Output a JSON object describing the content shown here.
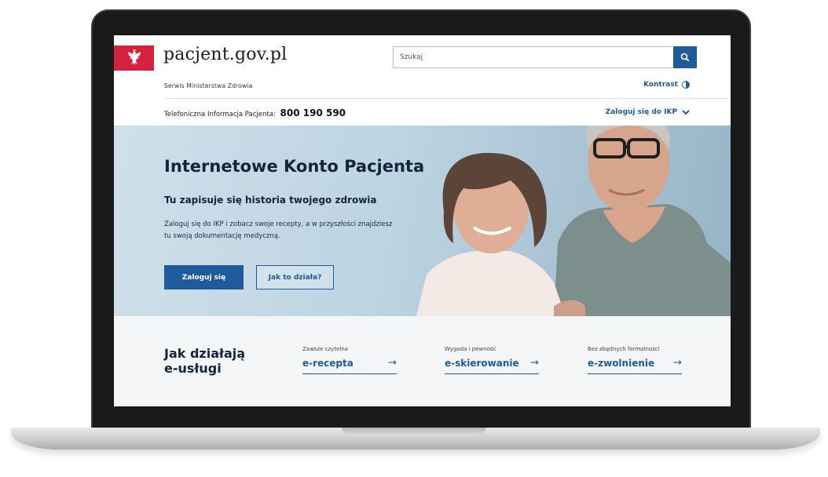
{
  "header": {
    "site_name": "pacjent.gov.pl",
    "subtitle": "Serwis Ministerstwa Zdrowia",
    "search_placeholder": "Szukaj",
    "contrast_label": "Kontrast",
    "hotline_label": "Telefoniczna Informacja Pacjenta:",
    "hotline_number": "800 190 590",
    "login_link": "Zaloguj się do IKP"
  },
  "hero": {
    "title": "Internetowe Konto Pacjenta",
    "subtitle": "Tu zapisuje się historia twojego zdrowia",
    "text": "Zaloguj się do IKP i zobacz swoje recepty, a w przyszłości znajdziesz tu swoją dokumentację medyczną.",
    "primary_button": "Zaloguj się",
    "secondary_button": "Jak to działa?"
  },
  "services": {
    "title_line1": "Jak działają",
    "title_line2": "e-usługi",
    "items": [
      {
        "caption": "Zawsze czytelna",
        "label": "e-recepta",
        "arrow": "→"
      },
      {
        "caption": "Wygoda i pewność",
        "label": "e-skierowanie",
        "arrow": "→"
      },
      {
        "caption": "Bez zbędnych formalności",
        "label": "e-zwolnienie",
        "arrow": "→"
      }
    ]
  },
  "colors": {
    "brand_blue": "#1f5b9a",
    "flag_red": "#d4213d"
  },
  "icons": [
    "eagle-emblem-icon",
    "search-icon",
    "contrast-icon",
    "chevron-down-icon",
    "arrow-right-icon"
  ]
}
